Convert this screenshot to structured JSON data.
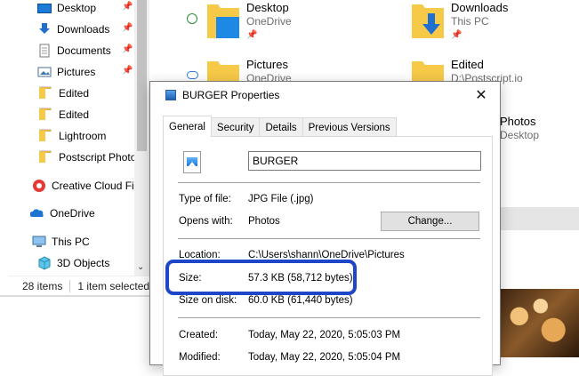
{
  "nav": {
    "items": [
      {
        "label": "Desktop",
        "icon": "desktop-icon",
        "pinned": true
      },
      {
        "label": "Downloads",
        "icon": "downloads-icon",
        "pinned": true
      },
      {
        "label": "Documents",
        "icon": "documents-icon",
        "pinned": true
      },
      {
        "label": "Pictures",
        "icon": "pictures-icon",
        "pinned": true
      },
      {
        "label": "Edited",
        "icon": "folder-icon"
      },
      {
        "label": "Edited",
        "icon": "folder-icon"
      },
      {
        "label": "Lightroom",
        "icon": "folder-icon"
      },
      {
        "label": "Postscript Photo",
        "icon": "folder-icon"
      },
      {
        "label": "Creative Cloud Fil",
        "icon": "creative-cloud-icon"
      },
      {
        "label": "OneDrive",
        "icon": "onedrive-icon"
      },
      {
        "label": "This PC",
        "icon": "this-pc-icon"
      },
      {
        "label": "3D Objects",
        "icon": "3d-objects-icon"
      }
    ]
  },
  "status": {
    "count": "28 items",
    "selected": "1 item selected"
  },
  "tiles": [
    {
      "name": "Desktop",
      "sub": "OneDrive"
    },
    {
      "name": "Downloads",
      "sub": "This PC"
    },
    {
      "name": "Pictures",
      "sub": "OneDrive"
    },
    {
      "name": "Edited",
      "sub": "D:\\Postscript.io"
    },
    {
      "name": "Photos",
      "sub": "Desktop"
    }
  ],
  "dialog": {
    "title": "BURGER Properties",
    "close": "✕",
    "tabs": [
      "General",
      "Security",
      "Details",
      "Previous Versions"
    ],
    "filename": "BURGER",
    "type_label": "Type of file:",
    "type_value": "JPG File (.jpg)",
    "opens_label": "Opens with:",
    "opens_value": "Photos",
    "change_button": "Change...",
    "location_label": "Location:",
    "location_value": "C:\\Users\\shann\\OneDrive\\Pictures",
    "size_label": "Size:",
    "size_value": "57.3 KB (58,712 bytes)",
    "disk_label": "Size on disk:",
    "disk_value": "60.0 KB (61,440 bytes)",
    "created_label": "Created:",
    "created_value": "Today, May 22, 2020, 5:05:03 PM",
    "modified_label": "Modified:",
    "modified_value": "Today, May 22, 2020, 5:05:04 PM"
  },
  "colors": {
    "highlight": "#1e46c8",
    "folder": "#f7c948"
  }
}
